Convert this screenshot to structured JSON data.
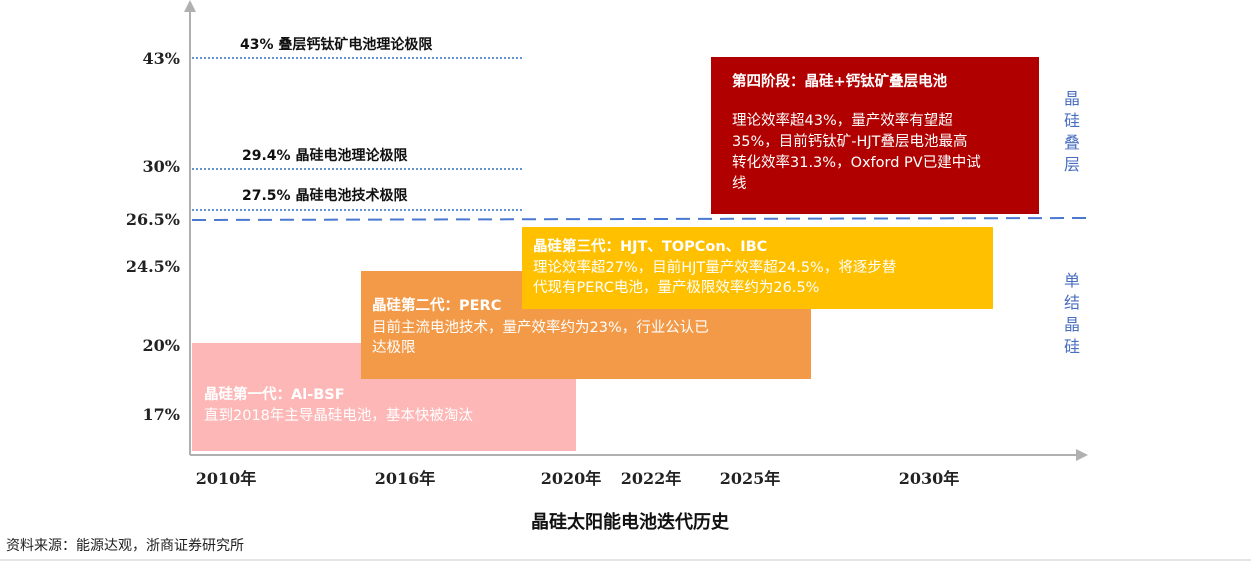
{
  "chart_data": {
    "type": "timeline",
    "title": "晶硅太阳能电池迭代历史",
    "source": "资料来源：能源达观，浙商证券研究所",
    "x_ticks": [
      {
        "label": "2010年",
        "year": 2010
      },
      {
        "label": "2016年",
        "year": 2016
      },
      {
        "label": "2020年",
        "year": 2020
      },
      {
        "label": "2022年",
        "year": 2022
      },
      {
        "label": "2025年",
        "year": 2025
      },
      {
        "label": "2030年",
        "year": 2030
      }
    ],
    "y_ticks": [
      {
        "label": "43%",
        "value": 43
      },
      {
        "label": "30%",
        "value": 30
      },
      {
        "label": "26.5%",
        "value": 26.5
      },
      {
        "label": "24.5%",
        "value": 24.5
      },
      {
        "label": "20%",
        "value": 20
      },
      {
        "label": "17%",
        "value": 17
      }
    ],
    "limit_lines": [
      {
        "value": 43,
        "label": "43% 叠层钙钛矿电池理论极限"
      },
      {
        "value": 30,
        "label": "29.4% 晶硅电池理论极限"
      },
      {
        "value": 27.5,
        "label": "27.5% 晶硅电池技术极限"
      }
    ],
    "divider": {
      "value": 26.5
    },
    "side_labels": [
      {
        "text": "晶硅叠层",
        "region": "upper"
      },
      {
        "text": "单结晶硅",
        "region": "lower"
      }
    ],
    "generations": [
      {
        "title": "晶硅第一代：Al-BSF",
        "lines": [
          "直到2018年主导晶硅电池，基本快被淘汰"
        ],
        "color": "#fdb7b7"
      },
      {
        "title": "晶硅第二代：PERC",
        "lines": [
          "目前主流电池技术，量产效率约为23%，行业公认已",
          "达极限"
        ],
        "color": "#f39a48"
      },
      {
        "title": "晶硅第三代：HJT、TOPCon、IBC",
        "lines": [
          "理论效率超27%，目前HJT量产效率超24.5%，将逐步替",
          "代现有PERC电池，量产极限效率约为26.5%"
        ],
        "color": "#ffc000"
      },
      {
        "title": "第四阶段：晶硅+钙钛矿叠层电池",
        "lines": [
          "理论效率超43%，量产效率有望超",
          "35%，目前钙钛矿-HJT叠层电池最高",
          "转化效率31.3%，Oxford PV已建中试",
          "线"
        ],
        "color": "#b00000"
      }
    ]
  }
}
